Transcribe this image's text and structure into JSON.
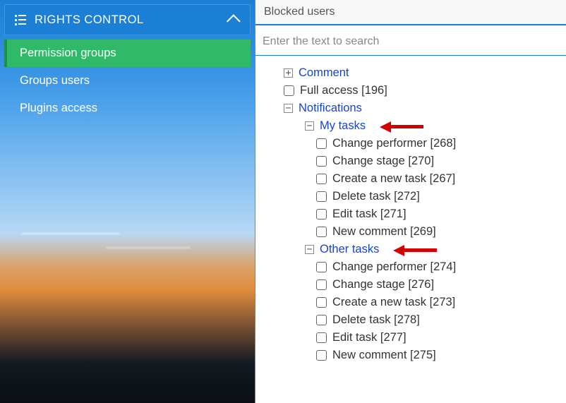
{
  "sidebar": {
    "header": "RIGHTS CONTROL",
    "items": [
      {
        "label": "Permission groups",
        "active": true
      },
      {
        "label": "Groups users",
        "active": false
      },
      {
        "label": "Plugins access",
        "active": false
      }
    ]
  },
  "tab": {
    "label": "Blocked users"
  },
  "search": {
    "placeholder": "Enter the text to search"
  },
  "tree": {
    "comment": "Comment",
    "full_access": "Full access [196]",
    "notifications": "Notifications",
    "my_tasks": {
      "label": "My tasks",
      "items": [
        "Change performer [268]",
        "Change stage [270]",
        "Create a new task [267]",
        "Delete task [272]",
        "Edit task [271]",
        "New comment [269]"
      ]
    },
    "other_tasks": {
      "label": "Other tasks",
      "items": [
        "Change performer [274]",
        "Change stage [276]",
        "Create a new task [273]",
        "Delete task [278]",
        "Edit task [277]",
        "New comment [275]"
      ]
    }
  },
  "glyphs": {
    "plus": "+",
    "minus": "−"
  }
}
